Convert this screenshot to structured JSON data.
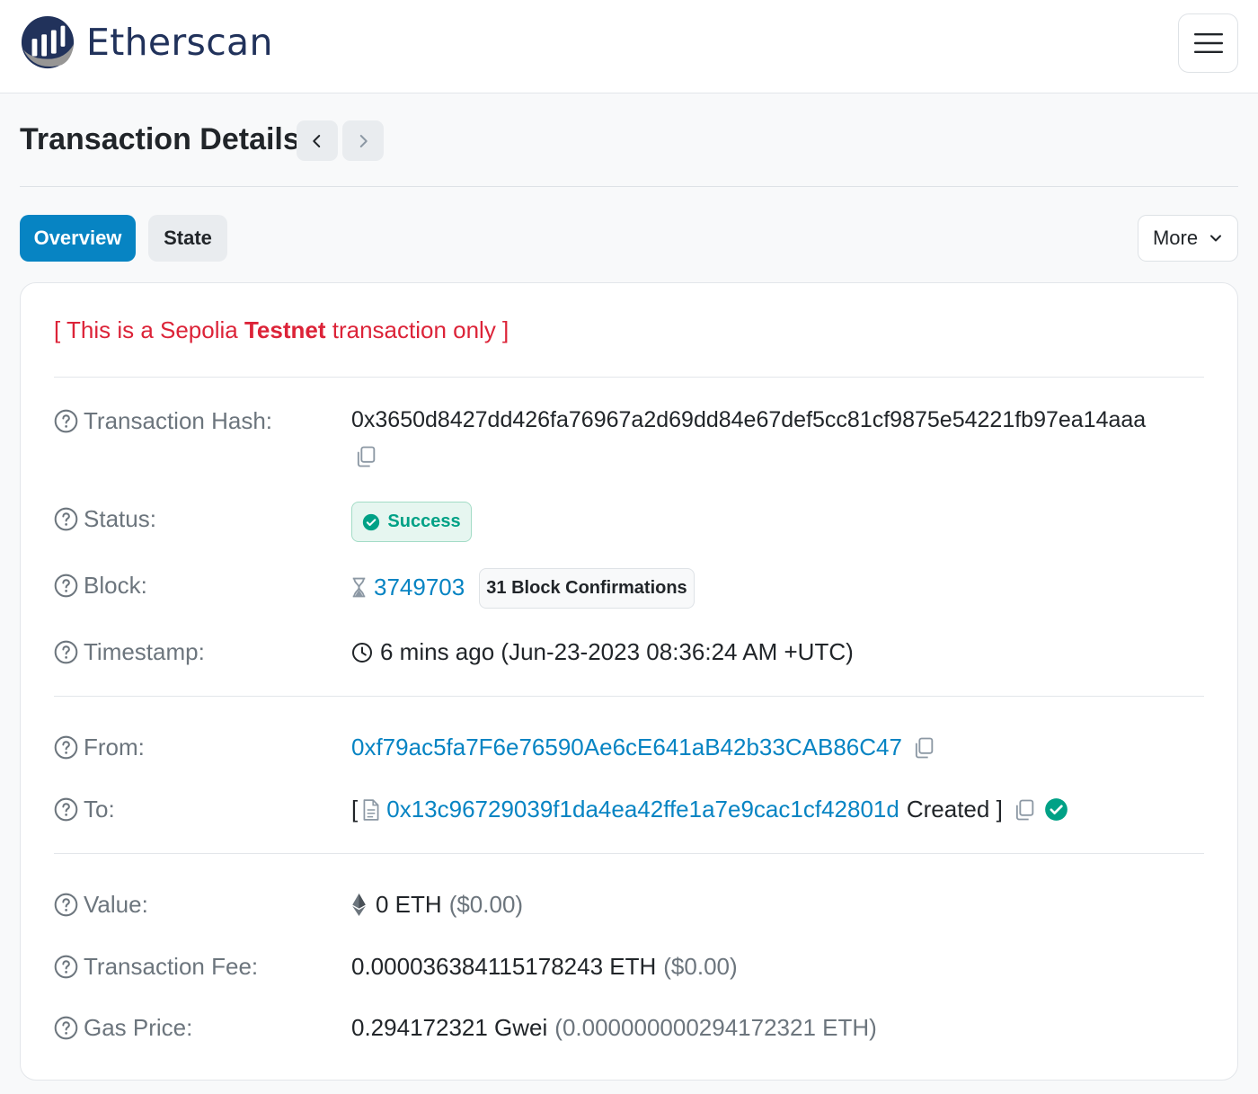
{
  "brand": {
    "name": "Etherscan"
  },
  "page": {
    "title": "Transaction Details"
  },
  "tabs": {
    "overview": "Overview",
    "state": "State",
    "more": "More"
  },
  "notice": {
    "prefix": "[ This is a Sepolia ",
    "emphasis": "Testnet",
    "suffix": " transaction only ]"
  },
  "fields": {
    "tx_hash": {
      "label": "Transaction Hash:",
      "value": "0x3650d8427dd426fa76967a2d69dd84e67def5cc81cf9875e54221fb97ea14aaa"
    },
    "status": {
      "label": "Status:",
      "value": "Success"
    },
    "block": {
      "label": "Block:",
      "value": "3749703",
      "confirmations": "31 Block Confirmations"
    },
    "timestamp": {
      "label": "Timestamp:",
      "value": "6 mins ago (Jun-23-2023 08:36:24 AM +UTC)"
    },
    "from": {
      "label": "From:",
      "value": "0xf79ac5fa7F6e76590Ae6cE641aB42b33CAB86C47"
    },
    "to": {
      "label": "To:",
      "open": "[",
      "value": "0x13c96729039f1da4ea42ffe1a7e9cac1cf42801d",
      "suffix": "Created ]"
    },
    "value": {
      "label": "Value:",
      "amount": "0 ETH",
      "usd": "($0.00)"
    },
    "fee": {
      "label": "Transaction Fee:",
      "amount": "0.000036384115178243 ETH",
      "usd": "($0.00)"
    },
    "gas_price": {
      "label": "Gas Price:",
      "amount": "0.294172321 Gwei",
      "eth": "(0.000000000294172321 ETH)"
    }
  },
  "colors": {
    "primary": "#0784c3",
    "brand_navy": "#21325b",
    "danger": "#dc2338",
    "success": "#00a186",
    "muted": "#6c757d"
  },
  "icons": [
    "etherscan-logo",
    "hamburger-icon",
    "chevron-left-icon",
    "chevron-right-icon",
    "chevron-down-icon",
    "question-circle-icon",
    "copy-icon",
    "check-circle-icon",
    "hourglass-icon",
    "clock-icon",
    "file-icon",
    "ethereum-icon"
  ]
}
